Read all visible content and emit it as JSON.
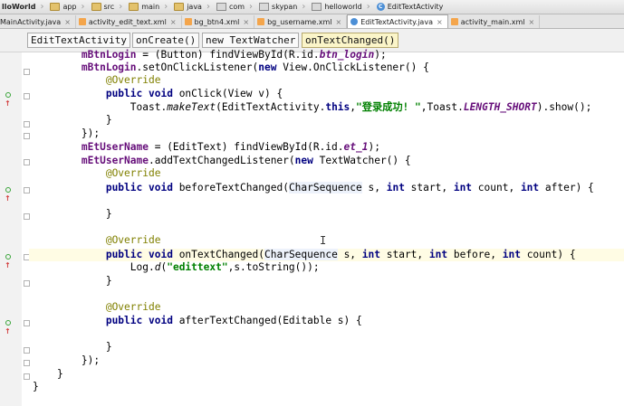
{
  "breadcrumb": {
    "items": [
      "lloWorld",
      "app",
      "src",
      "main",
      "java",
      "com",
      "skypan",
      "helloworld",
      "EditTextActivity"
    ],
    "separator": "›"
  },
  "tabs": [
    {
      "label": "MainActivity.java",
      "type": "java",
      "active": false
    },
    {
      "label": "activity_edit_text.xml",
      "type": "xml",
      "active": false
    },
    {
      "label": "bg_btn4.xml",
      "type": "xml",
      "active": false
    },
    {
      "label": "bg_username.xml",
      "type": "xml",
      "active": false
    },
    {
      "label": "EditTextActivity.java",
      "type": "cls",
      "active": true
    },
    {
      "label": "activity_main.xml",
      "type": "xml",
      "active": false
    }
  ],
  "tab_close_glyph": "×",
  "nav": {
    "class_name": "EditTextActivity",
    "method": "onCreate()",
    "anon": "new TextWatcher",
    "current": "onTextChanged()"
  },
  "code": {
    "l1": {
      "a": "        ",
      "b": "mBtnLogin",
      "c": " = (Button) findViewById(R.id.",
      "d": "btn_login",
      "e": ");"
    },
    "l2": {
      "a": "        ",
      "b": "mBtnLogin",
      "c": ".setOnClickListener(",
      "kw": "new",
      "d": " View.OnClickListener() {"
    },
    "l3": {
      "a": "            ",
      "ann": "@Override"
    },
    "l4": {
      "a": "            ",
      "kw1": "public",
      "s1": " ",
      "kw2": "void",
      "d": " onClick(View v) {"
    },
    "l5": {
      "a": "                Toast.",
      "m": "makeText",
      "b": "(EditTextActivity.",
      "kw": "this",
      "c": ",",
      "str": "\"登录成功! \"",
      "d": ",Toast.",
      "f": "LENGTH_SHORT",
      "e": ").show();"
    },
    "l6": {
      "a": "            }"
    },
    "l7": {
      "a": "        });"
    },
    "l8": {
      "a": "        ",
      "b": "mEtUserName",
      "c": " = (EditText) findViewById(R.id.",
      "d": "et_1",
      "e": ");"
    },
    "l9": {
      "a": "        ",
      "b": "mEtUserName",
      "c": ".addTextChangedListener(",
      "kw": "new",
      "d": " TextWatcher() {"
    },
    "l10": {
      "a": "            ",
      "ann": "@Override"
    },
    "l11": {
      "a": "            ",
      "kw1": "public",
      "s1": " ",
      "kw2": "void",
      "b": " beforeTextChanged(",
      "t": "CharSequence",
      "c": " s, ",
      "kw3": "int",
      "d": " start, ",
      "kw4": "int",
      "e": " count, ",
      "kw5": "int",
      "f": " after) {"
    },
    "l12": {
      "a": "            }"
    },
    "l13": {
      "a": "            ",
      "ann": "@Override"
    },
    "l14": {
      "a": "            ",
      "kw1": "public",
      "s1": " ",
      "kw2": "void",
      "b": " onTextChanged(",
      "t": "CharSequence",
      "c": " s, ",
      "kw3": "int",
      "d": " start, ",
      "kw4": "int",
      "e": " before, ",
      "kw5": "int",
      "f": " count) {"
    },
    "l15": {
      "a": "                Log.",
      "m": "d",
      "b": "(",
      "str": "\"edittext\"",
      "c": ",s.toString());"
    },
    "l16": {
      "a": "            }"
    },
    "l17": {
      "a": "            ",
      "ann": "@Override"
    },
    "l18": {
      "a": "            ",
      "kw1": "public",
      "s1": " ",
      "kw2": "void",
      "d": " afterTextChanged(Editable s) {"
    },
    "l19": {
      "a": "            }"
    },
    "l20": {
      "a": "        });"
    },
    "l21": {
      "a": "    }"
    },
    "l22": {
      "a": "}"
    }
  },
  "text_cursor_glyph": "I"
}
